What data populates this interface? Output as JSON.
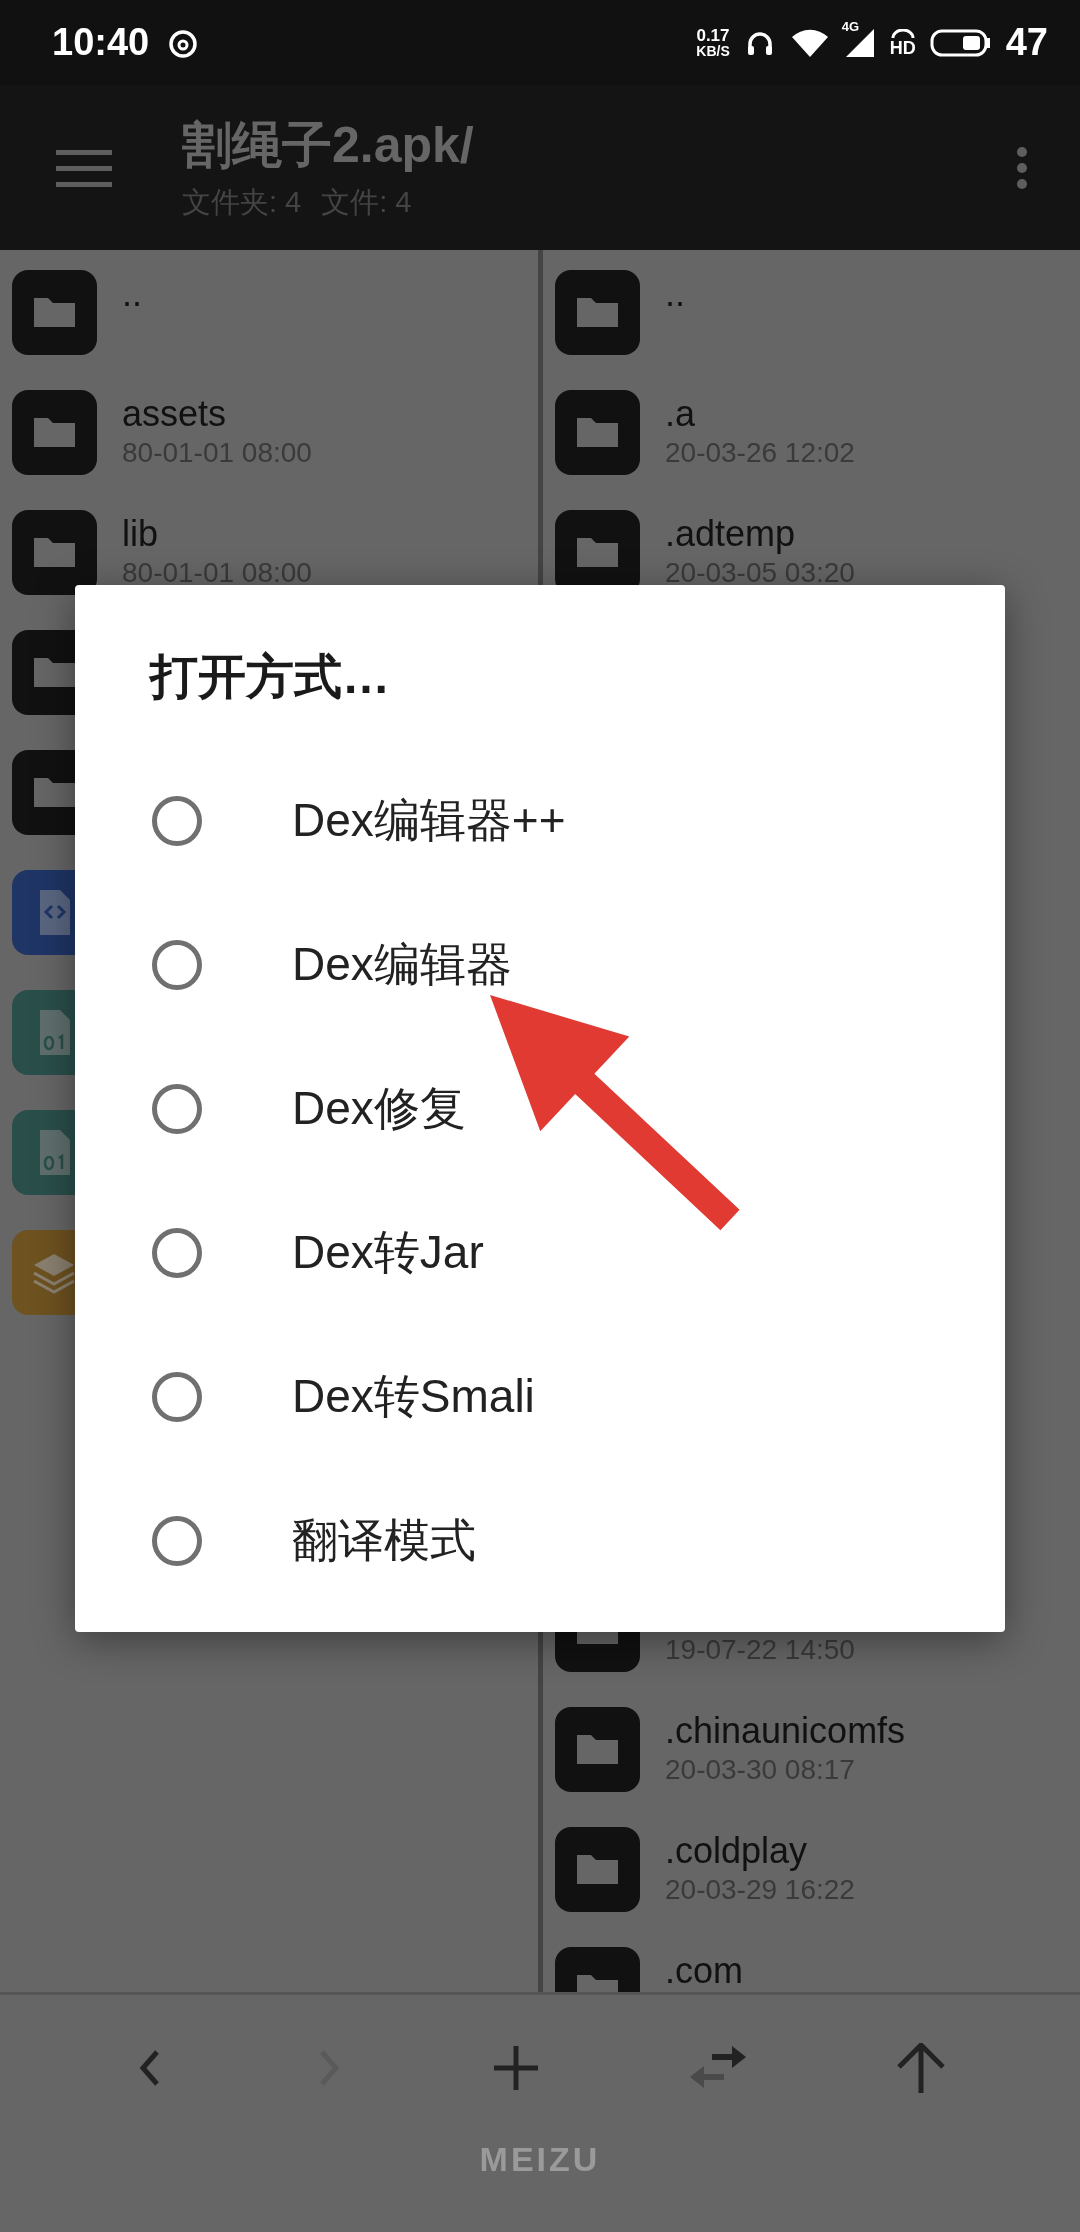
{
  "status_bar": {
    "time": "10:40",
    "net_speed": "0.17",
    "net_unit": "KB/S",
    "network": "4G",
    "hd_label": "HD",
    "battery": "47"
  },
  "header": {
    "title": "割绳子2.apk/",
    "folders": "文件夹: 4",
    "files": "文件: 4"
  },
  "left_pane": {
    "items": [
      {
        "kind": "folder",
        "name": ".."
      },
      {
        "kind": "folder",
        "name": "assets",
        "date": "80-01-01 08:00"
      },
      {
        "kind": "folder",
        "name": "lib",
        "date": "80-01-01 08:00"
      },
      {
        "kind": "folder"
      },
      {
        "kind": "folder"
      },
      {
        "kind": "code"
      },
      {
        "kind": "binary"
      },
      {
        "kind": "binary"
      },
      {
        "kind": "layers"
      }
    ]
  },
  "right_pane": {
    "top_items": [
      {
        "kind": "folder",
        "name": ".."
      },
      {
        "kind": "folder",
        "name": ".a",
        "date": "20-03-26 12:02"
      },
      {
        "kind": "folder",
        "name": ".adtemp",
        "date": "20-03-05 03:20"
      }
    ],
    "bottom_items": [
      {
        "kind": "folder",
        "date": "19-07-22 14:50"
      },
      {
        "kind": "folder",
        "name": ".chinaunicomfs",
        "date": "20-03-30 08:17"
      },
      {
        "kind": "folder",
        "name": ".coldplay",
        "date": "20-03-29 16:22"
      },
      {
        "kind": "folder",
        "name": ".com"
      }
    ]
  },
  "dialog": {
    "title": "打开方式…",
    "options": [
      {
        "label": "Dex编辑器++",
        "selected": false
      },
      {
        "label": "Dex编辑器",
        "selected": false
      },
      {
        "label": "Dex修复",
        "selected": false
      },
      {
        "label": "Dex转Jar",
        "selected": false
      },
      {
        "label": "Dex转Smali",
        "selected": false
      },
      {
        "label": "翻译模式",
        "selected": false
      }
    ]
  },
  "toolbar": {
    "buttons": [
      {
        "kind": "back",
        "disabled": false
      },
      {
        "kind": "forward",
        "disabled": true
      },
      {
        "kind": "add",
        "disabled": false
      },
      {
        "kind": "swap",
        "disabled": false
      },
      {
        "kind": "up",
        "disabled": false
      }
    ]
  },
  "brand": "MEIZU"
}
